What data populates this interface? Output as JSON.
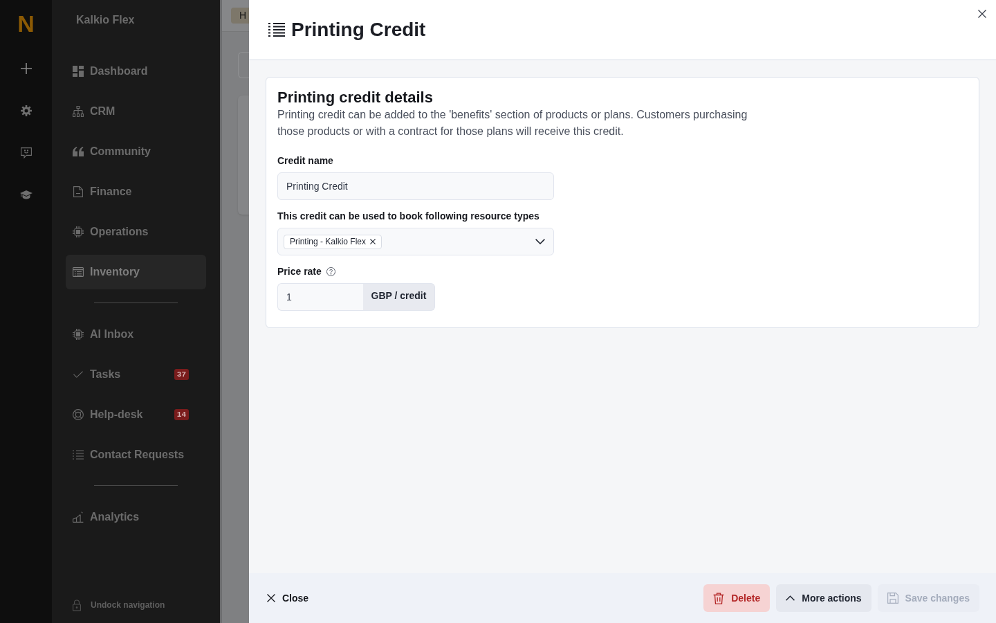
{
  "logo": "N",
  "sidebar": {
    "title": "Kalkio Flex",
    "sections": [
      {
        "items": [
          {
            "label": "Dashboard",
            "selected": false
          },
          {
            "label": "CRM",
            "selected": false
          },
          {
            "label": "Community",
            "selected": false
          },
          {
            "label": "Finance",
            "selected": false
          },
          {
            "label": "Operations",
            "selected": false
          },
          {
            "label": "Inventory",
            "selected": true
          }
        ]
      },
      {
        "items": [
          {
            "label": "AI Inbox",
            "selected": false
          },
          {
            "label": "Tasks",
            "selected": false,
            "badge": "37"
          },
          {
            "label": "Help-desk",
            "selected": false,
            "badge": "14"
          },
          {
            "label": "Contact Requests",
            "selected": false
          }
        ]
      },
      {
        "items": [
          {
            "label": "Analytics",
            "selected": false
          }
        ]
      }
    ],
    "undock": "Undock navigation"
  },
  "background": {
    "tab": "H"
  },
  "panel": {
    "title": "Printing Credit",
    "card": {
      "title": "Printing credit details",
      "description": "Printing credit can be added to the 'benefits' section of products or plans. Customers purchasing those products or with a contract for those plans will receive this credit.",
      "fields": [
        {
          "kind": "text",
          "label": "Credit name",
          "value": "Printing Credit"
        },
        {
          "kind": "multiselect",
          "label": "This credit can be used to book following resource types",
          "chips": [
            "Printing - Kalkio Flex"
          ]
        },
        {
          "kind": "suffix",
          "label": "Price rate",
          "help": true,
          "value": "1",
          "suffix": "GBP / credit"
        }
      ]
    },
    "footer": {
      "close": "Close",
      "buttons": [
        {
          "kind": "danger",
          "label": "Delete",
          "disabled": false
        },
        {
          "kind": "secondary",
          "label": "More actions",
          "disabled": false
        },
        {
          "kind": "primary",
          "label": "Save changes",
          "disabled": true
        }
      ]
    }
  }
}
